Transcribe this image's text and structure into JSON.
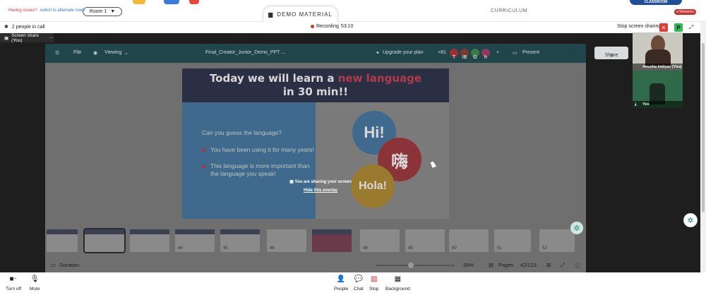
{
  "topbar": {
    "issue_text": "Having issues?",
    "alternate_room_link": "switch to alternate room",
    "room_label": "Room 1",
    "demo_tab": "DEMO MATERIAL",
    "curriculum_tab": "CURRICULUM",
    "classroom_badge": "CLASSROOM",
    "moments_badge": "Moments"
  },
  "callbar": {
    "people_count": "2 people in call",
    "recording_label": "Recording",
    "recording_time": "53:10",
    "stop_sharing": "Stop screen sharing",
    "colors": {
      "stop": "#e53935",
      "accent": "#2bbf4b"
    }
  },
  "share": {
    "tab_label": "Screen share (You)",
    "canvas_header": {
      "file": "File",
      "viewing": "Viewing",
      "doc_title": "Final_Creator_Junior_Demo_PPT ...",
      "upgrade": "Upgrade your plan",
      "count": "+81",
      "avatars": [
        {
          "letter": "T",
          "color": "#9b2f35"
        },
        {
          "letter": "IB",
          "color": "#7a3a30"
        },
        {
          "letter": "G",
          "color": "#3c7a45"
        },
        {
          "letter": "h",
          "color": "#8a3a5c"
        }
      ],
      "present": "Present",
      "share": "Share"
    },
    "slide": {
      "title_line1_pre": "Today we will learn a ",
      "title_highlight": "new language",
      "title_line2": "in 30 min!!",
      "question": "Can you guess the language?",
      "bullets": [
        "You have been using it for many years!",
        "This language is more important than the language you speak!"
      ],
      "bubbles": [
        {
          "text": "Hi!",
          "color": "#3f6a8e"
        },
        {
          "text": "嗨",
          "color": "#8a3339"
        },
        {
          "text": "Hola!",
          "color": "#9a7a2f"
        }
      ]
    },
    "overlay": {
      "message": "You are sharing your screen",
      "hide_link": "Hide this overlay"
    },
    "thumbnails": [
      "",
      "",
      "",
      "44",
      "45",
      "46",
      "",
      "48",
      "49",
      "50",
      "51",
      "52",
      "53"
    ],
    "footer": {
      "duration": "Duration",
      "zoom": "39%",
      "pages": "Pages",
      "page_counter": "42/123"
    }
  },
  "participants": [
    {
      "name": "Anusha Imtiyaz (You)"
    },
    {
      "name": "Yes"
    }
  ],
  "toolbar": {
    "turn_off": "Turn off",
    "mute": "Mute",
    "people": "People",
    "chat": "Chat",
    "stop": "Stop",
    "background": "Background"
  }
}
